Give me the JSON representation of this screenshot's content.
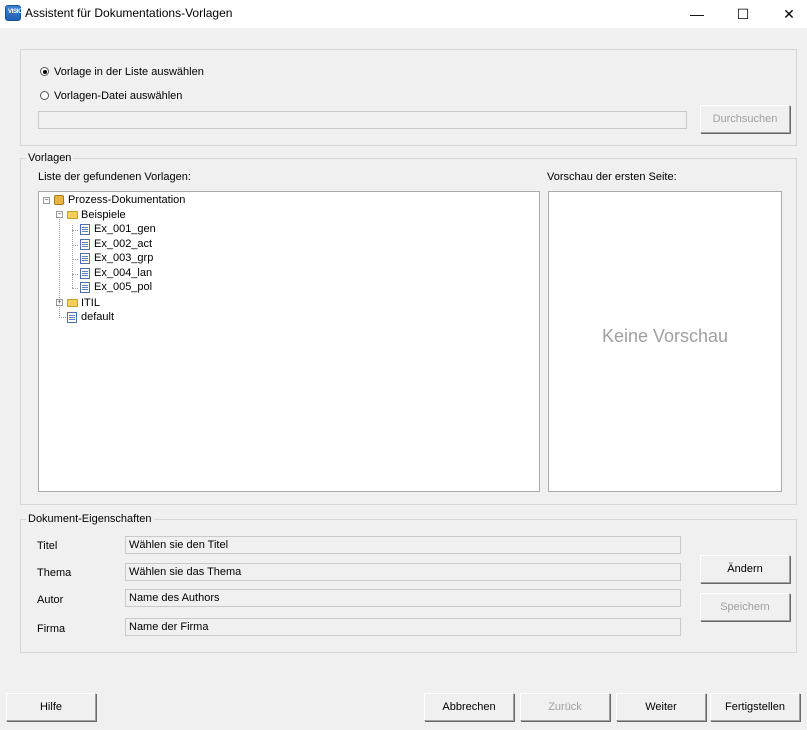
{
  "window": {
    "title": "Assistent für Dokumentations-Vorlagen",
    "minimize": "—",
    "maximize": "☐",
    "close": "✕"
  },
  "source": {
    "radio_list": "Vorlage in der Liste auswählen",
    "radio_file": "Vorlagen-Datei auswählen",
    "radio_list_selected": true,
    "file_path": "",
    "browse_button": "Durchsuchen"
  },
  "templates": {
    "group_label": "Vorlagen",
    "list_label": "Liste der gefundenen Vorlagen:",
    "preview_label": "Vorschau der ersten Seite:",
    "preview_empty": "Keine Vorschau",
    "tree": {
      "root": "Prozess-Dokumentation",
      "beispiele": "Beispiele",
      "items": [
        "Ex_001_gen",
        "Ex_002_act",
        "Ex_003_grp",
        "Ex_004_lan",
        "Ex_005_pol"
      ],
      "itil": "ITIL",
      "default": "default"
    }
  },
  "properties": {
    "group_label": "Dokument-Eigenschaften",
    "title_label": "Titel",
    "title_value": "Wählen sie den Titel",
    "topic_label": "Thema",
    "topic_value": "Wählen sie das Thema",
    "author_label": "Autor",
    "author_value": "Name des Authors",
    "company_label": "Firma",
    "company_value": "Name der Firma",
    "change_button": "Ändern",
    "save_button": "Speichern"
  },
  "footer": {
    "help": "Hilfe",
    "cancel": "Abbrechen",
    "back": "Zurück",
    "next": "Weiter",
    "finish": "Fertigstellen"
  }
}
